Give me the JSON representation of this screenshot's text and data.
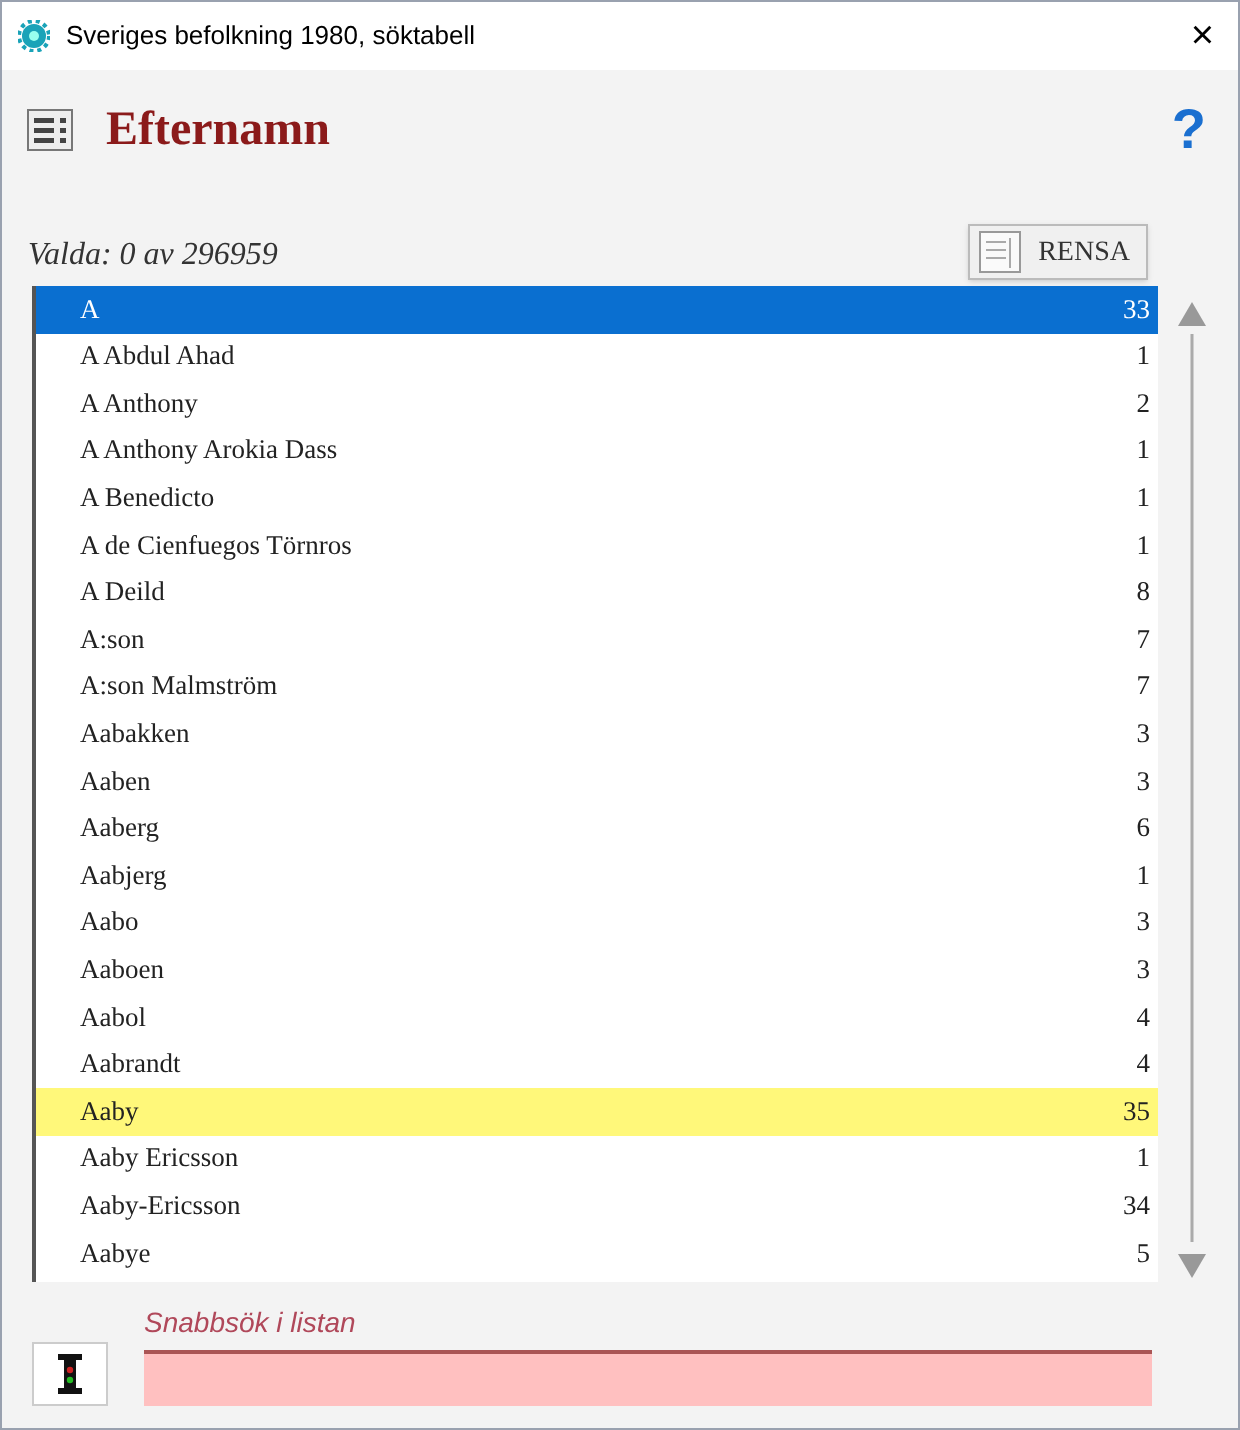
{
  "window": {
    "title": "Sveriges befolkning 1980, söktabell",
    "close": "×"
  },
  "header": {
    "title": "Efternamn",
    "help": "?"
  },
  "selection": {
    "summary": "Valda: 0 av 296959",
    "clear_button": "RENSA"
  },
  "list": {
    "rows": [
      {
        "name": "A",
        "count": "33",
        "selected": true,
        "highlighted": false
      },
      {
        "name": "A Abdul Ahad",
        "count": "1",
        "selected": false,
        "highlighted": false
      },
      {
        "name": "A Anthony",
        "count": "2",
        "selected": false,
        "highlighted": false
      },
      {
        "name": "A Anthony Arokia Dass",
        "count": "1",
        "selected": false,
        "highlighted": false
      },
      {
        "name": "A Benedicto",
        "count": "1",
        "selected": false,
        "highlighted": false
      },
      {
        "name": "A de Cienfuegos Törnros",
        "count": "1",
        "selected": false,
        "highlighted": false
      },
      {
        "name": "A Deild",
        "count": "8",
        "selected": false,
        "highlighted": false
      },
      {
        "name": "A:son",
        "count": "7",
        "selected": false,
        "highlighted": false
      },
      {
        "name": "A:son Malmström",
        "count": "7",
        "selected": false,
        "highlighted": false
      },
      {
        "name": "Aabakken",
        "count": "3",
        "selected": false,
        "highlighted": false
      },
      {
        "name": "Aaben",
        "count": "3",
        "selected": false,
        "highlighted": false
      },
      {
        "name": "Aaberg",
        "count": "6",
        "selected": false,
        "highlighted": false
      },
      {
        "name": "Aabjerg",
        "count": "1",
        "selected": false,
        "highlighted": false
      },
      {
        "name": "Aabo",
        "count": "3",
        "selected": false,
        "highlighted": false
      },
      {
        "name": "Aaboen",
        "count": "3",
        "selected": false,
        "highlighted": false
      },
      {
        "name": "Aabol",
        "count": "4",
        "selected": false,
        "highlighted": false
      },
      {
        "name": "Aabrandt",
        "count": "4",
        "selected": false,
        "highlighted": false
      },
      {
        "name": "Aaby",
        "count": "35",
        "selected": false,
        "highlighted": true
      },
      {
        "name": "Aaby Ericsson",
        "count": "1",
        "selected": false,
        "highlighted": false
      },
      {
        "name": "Aaby-Ericsson",
        "count": "34",
        "selected": false,
        "highlighted": false
      },
      {
        "name": "Aabye",
        "count": "5",
        "selected": false,
        "highlighted": false
      }
    ]
  },
  "quick_search": {
    "label": "Snabbsök i listan"
  }
}
